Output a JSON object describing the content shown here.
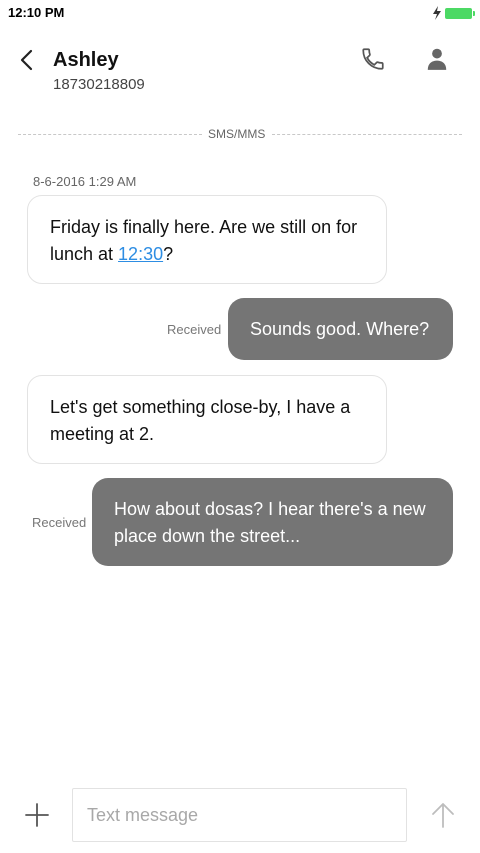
{
  "status_bar": {
    "time": "12:10 PM",
    "battery_color": "#4cd964"
  },
  "header": {
    "contact_name": "Ashley",
    "contact_number": "18730218809",
    "icons": [
      "back-arrow",
      "phone",
      "person"
    ]
  },
  "thread": {
    "divider_label": "SMS/MMS",
    "timestamp": "8-6-2016 1:29 AM",
    "messages": [
      {
        "direction": "incoming",
        "text_before": "Friday is finally here. Are we still on for lunch at ",
        "link": "12:30",
        "text_after": "?"
      },
      {
        "direction": "outgoing",
        "status": "Received",
        "text": "Sounds good. Where?"
      },
      {
        "direction": "incoming",
        "text": "Let's get something close-by, I have a meeting at 2."
      },
      {
        "direction": "outgoing",
        "status": "Received",
        "text": "How about dosas? I hear there's a new place down the street..."
      }
    ]
  },
  "composer": {
    "placeholder": "Text message",
    "icons": [
      "plus",
      "send-arrow-up"
    ]
  },
  "colors": {
    "outgoing_bubble": "#757575",
    "link": "#2d8de3"
  }
}
